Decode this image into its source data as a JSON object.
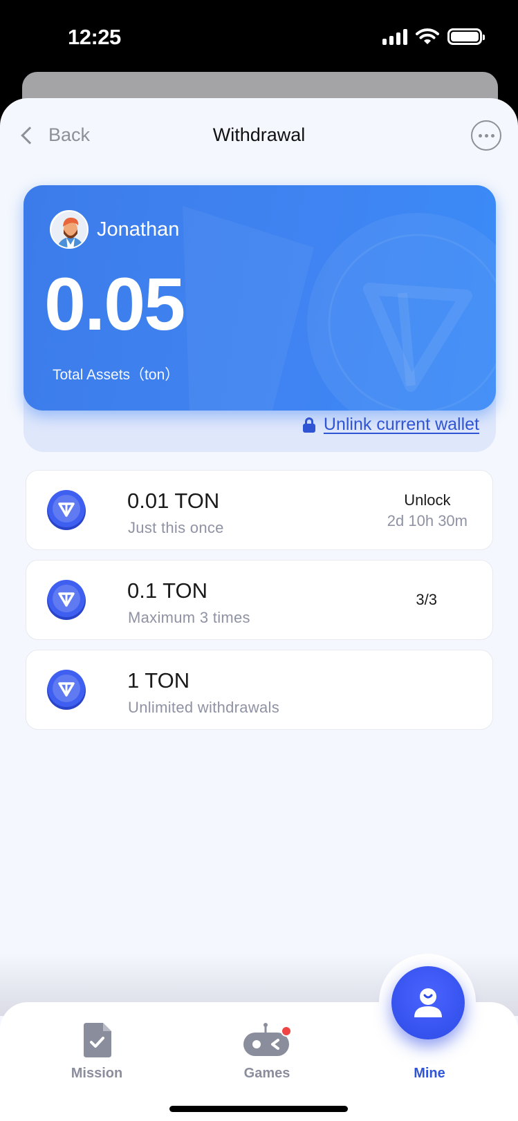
{
  "status_bar": {
    "time": "12:25"
  },
  "nav": {
    "back_label": "Back",
    "title": "Withdrawal"
  },
  "asset_card": {
    "user_name": "Jonathan",
    "amount": "0.05",
    "amount_label": "Total Assets（ton）",
    "unlink_label": "Unlink current wallet"
  },
  "options": [
    {
      "amount": "0.01 TON",
      "sub": "Just this once",
      "right_line1": "Unlock",
      "right_line2": "2d 10h 30m"
    },
    {
      "amount": "0.1 TON",
      "sub": "Maximum 3 times",
      "right_line1": "3/3"
    },
    {
      "amount": "1 TON",
      "sub": "Unlimited withdrawals"
    }
  ],
  "tabs": {
    "mission": "Mission",
    "games": "Games",
    "mine": "Mine"
  },
  "colors": {
    "accent": "#2f55d4",
    "card_blue": "#3f84f2",
    "badge_red": "#f04444"
  },
  "icons": [
    "signal-icon",
    "wifi-icon",
    "battery-icon",
    "chevron-left-icon",
    "more-icon",
    "lock-icon",
    "ton-coin-icon",
    "mission-icon",
    "gamepad-icon",
    "user-icon"
  ]
}
